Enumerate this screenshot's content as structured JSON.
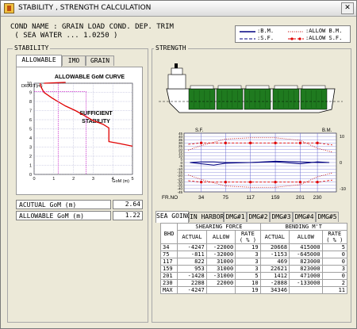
{
  "window": {
    "title": "STABILITY , STRENGTH CALCULATION",
    "close_glyph": "✕"
  },
  "condition": {
    "line1": "COND NAME : GRAIN LOAD COND. DEP. TRIM",
    "line2": "( SEA WATER ... 1.0250 )"
  },
  "legend": {
    "bm": ":B.M.",
    "sf": ":S.F.",
    "allow_bm": ":ALLOW B.M.",
    "allow_sf": ":ALLOW S.F."
  },
  "stability": {
    "group_label": "STABILITY",
    "tabs": [
      "ALLOWABLE",
      "IMO",
      "GRAIN"
    ],
    "active_tab": 0,
    "chart_title": "ALLOWABLE GoM CURVE",
    "ylabel": "DRAFT(m)",
    "xlabel": "GoM (m)",
    "region_label_1": "SUFFICIENT",
    "region_label_2": "STABILITY",
    "acutual_gom_label": "ACUTUAL GoM   (m)",
    "acutual_gom_value": "2.64",
    "allowable_gom_label": "ALLOWABLE GoM  (m)",
    "allowable_gom_value": "1.22"
  },
  "strength": {
    "group_label": "STRENGTH",
    "sf_label": "S.F.",
    "bm_label": "B.M.",
    "frno_label": "FR.NO",
    "frames": [
      "34",
      "75",
      "117",
      "159",
      "201",
      "230"
    ],
    "tabs": [
      "SEA GOING",
      "IN HARBOR",
      "DMG#1",
      "DMG#2",
      "DMG#3",
      "DMG#4",
      "DMG#5"
    ],
    "active_tab": 0,
    "headers": {
      "bhd": "BHD",
      "shearing": "SHEARING FORCE",
      "bending": "BENDING M'T",
      "actual": "ACTUAL",
      "allow": "ALLOW",
      "rate": "RATE",
      "rate_unit": "( % )"
    },
    "rows": [
      [
        "34",
        "-4247",
        "-22000",
        "19",
        "20668",
        "415000",
        "5"
      ],
      [
        "75",
        "-811",
        "-32000",
        "3",
        "-1153",
        "-645000",
        "0"
      ],
      [
        "117",
        "822",
        "31000",
        "3",
        "469",
        "823000",
        "0"
      ],
      [
        "159",
        "953",
        "31000",
        "3",
        "22621",
        "823000",
        "3"
      ],
      [
        "201",
        "-1428",
        "-31000",
        "5",
        "1412",
        "471000",
        "0"
      ],
      [
        "230",
        "2288",
        "22000",
        "10",
        "-2888",
        "-133000",
        "2"
      ],
      [
        "MAX",
        "-4247",
        "",
        "19",
        "34346",
        "",
        "11"
      ]
    ]
  },
  "chart_data": [
    {
      "type": "line",
      "title": "ALLOWABLE GoM CURVE",
      "xlabel": "GoM (m)",
      "ylabel": "DRAFT(m)",
      "xlim": [
        0,
        5
      ],
      "ylim": [
        0,
        10
      ],
      "x_ticks": [
        0,
        1,
        2,
        3,
        4,
        5
      ],
      "y_ticks": [
        0,
        1,
        2,
        3,
        4,
        5,
        6,
        7,
        8,
        9,
        10
      ],
      "series": [
        {
          "color": "#e00000",
          "x": [
            0.3,
            0.35,
            0.5,
            0.9,
            1.2,
            1.6,
            2.1,
            2.6,
            3.0,
            3.5,
            3.8,
            3.8,
            4.3,
            5.0
          ],
          "y": [
            10.0,
            9.6,
            9.0,
            8.4,
            8.0,
            7.5,
            7.0,
            6.4,
            5.9,
            5.5,
            5.1,
            3.6,
            3.4,
            3.1
          ]
        },
        {
          "color": "#e00000",
          "x": [
            0.5,
            1.6
          ],
          "y": [
            10.0,
            10.1
          ]
        }
      ],
      "markers": {
        "actual_gom": 2.64,
        "allowable_gom": 1.22,
        "draft": 9.1
      }
    },
    {
      "type": "line",
      "title": "",
      "x_categories": [
        "34",
        "75",
        "117",
        "159",
        "201",
        "230"
      ],
      "x_positions": [
        34,
        75,
        117,
        159,
        201,
        230
      ],
      "xlim": [
        5,
        262
      ],
      "ylim": [
        -45,
        45
      ],
      "sf_ticks": [
        45,
        40,
        35,
        30,
        25,
        20,
        15,
        10,
        5,
        0,
        -5,
        -10,
        -15,
        -20,
        -25,
        -30,
        -35,
        -40,
        -45
      ],
      "bm_ticks": [
        10,
        0,
        -10
      ],
      "series": [
        {
          "color": "#e00000",
          "style": "dashed",
          "x": [
            12,
            34,
            75,
            117,
            159,
            201,
            230,
            255
          ],
          "y": [
            28,
            30,
            30,
            30,
            30,
            30,
            30,
            27
          ]
        },
        {
          "color": "#e00000",
          "style": "dashed",
          "x": [
            12,
            34,
            75,
            117,
            159,
            201,
            230,
            255
          ],
          "y": [
            -28,
            -30,
            -30,
            -30,
            -30,
            -30,
            -30,
            -27
          ]
        },
        {
          "color": "#c00000",
          "style": "dotted",
          "x": [
            12,
            34,
            75,
            117,
            159,
            201,
            230,
            255
          ],
          "y": [
            19,
            26,
            36,
            38,
            38,
            34,
            22,
            16
          ]
        },
        {
          "color": "#c00000",
          "style": "dotted",
          "x": [
            12,
            34,
            75,
            117,
            159,
            201,
            230,
            255
          ],
          "y": [
            -19,
            -26,
            -36,
            -38,
            -38,
            -34,
            -22,
            -16
          ]
        },
        {
          "color": "#000080",
          "style": "solid",
          "x": [
            15,
            34,
            55,
            75,
            117,
            159,
            201,
            230,
            250
          ],
          "y": [
            0,
            -2,
            -4,
            -1,
            0,
            1,
            -2,
            1,
            0
          ]
        },
        {
          "color": "#000080",
          "style": "solid",
          "x": [
            15,
            34,
            55,
            75,
            117,
            159,
            201,
            230,
            250
          ],
          "y": [
            0,
            1,
            1,
            0,
            0,
            2,
            1,
            0,
            0
          ]
        }
      ]
    }
  ]
}
